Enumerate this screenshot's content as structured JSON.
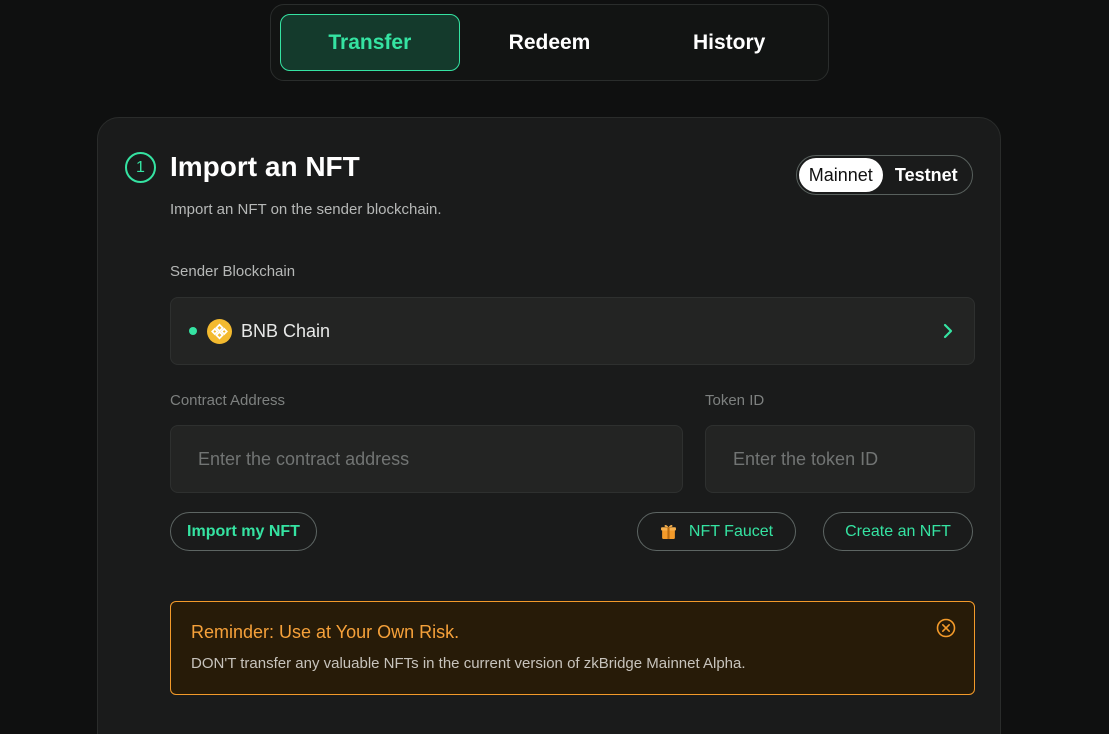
{
  "tabs": [
    {
      "label": "Transfer",
      "active": true
    },
    {
      "label": "Redeem",
      "active": false
    },
    {
      "label": "History",
      "active": false
    }
  ],
  "step": {
    "number": "1",
    "title": "Import an NFT",
    "subtitle": "Import an NFT on the sender blockchain."
  },
  "network": {
    "options": [
      "Mainnet",
      "Testnet"
    ],
    "selected": "Mainnet"
  },
  "sender": {
    "label": "Sender Blockchain",
    "chain_name": "BNB Chain",
    "chain_icon": "bnb-chain-icon"
  },
  "contract": {
    "label": "Contract Address",
    "placeholder": "Enter the contract address",
    "value": ""
  },
  "token": {
    "label": "Token ID",
    "placeholder": "Enter the token ID",
    "value": ""
  },
  "buttons": {
    "import": "Import my NFT",
    "faucet": "NFT Faucet",
    "create": "Create an NFT"
  },
  "reminder": {
    "title": "Reminder: Use at Your Own Risk.",
    "text": "DON'T transfer any valuable NFTs in the current version of zkBridge Mainnet Alpha."
  },
  "colors": {
    "accent": "#35e3a2",
    "warning": "#f39a2a",
    "background": "#0f1010",
    "card": "#1a1b1b"
  }
}
